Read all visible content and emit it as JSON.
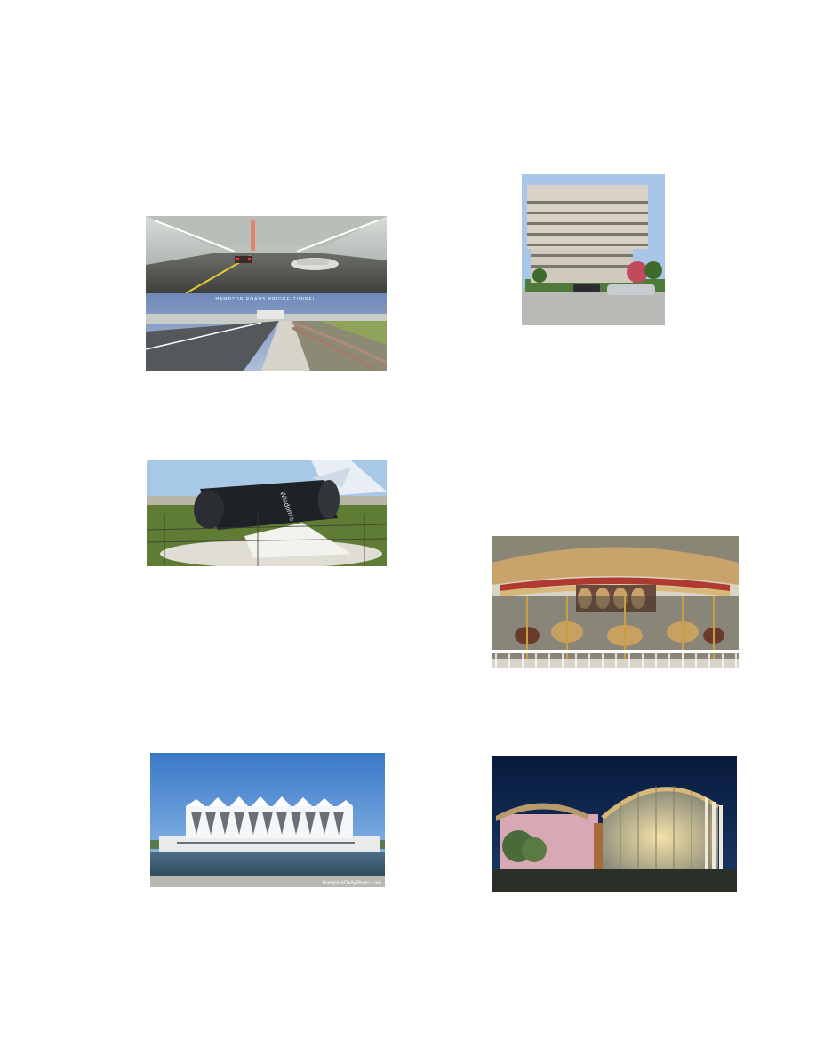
{
  "page": {
    "background": "#ffffff"
  },
  "photos": {
    "tunnel": {
      "caption_text": "HAMPTON ROADS BRIDGE-TUNNEL"
    },
    "bottle": {
      "bottle_text": "Wisdom's"
    },
    "coliseum": {
      "watermark": "HamptonDailyPhoto.com"
    }
  }
}
